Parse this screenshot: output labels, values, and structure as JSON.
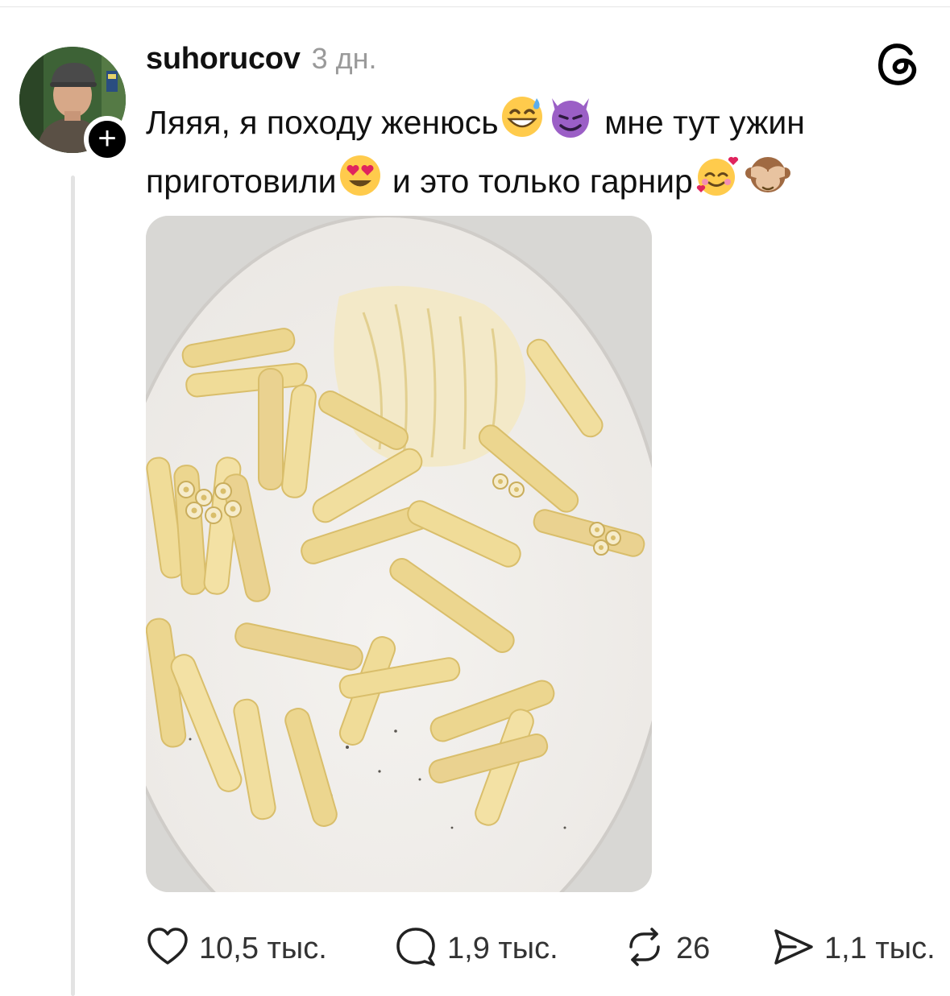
{
  "post": {
    "username": "suhorucov",
    "time_ago": "3 дн.",
    "follow_symbol": "+",
    "text_parts": [
      "Ляяя, я походу женюсь",
      "мне тут ужин",
      "приготовили",
      "и это только гарнир"
    ],
    "emoji_icons": [
      "grinning-sweat-emoji",
      "smiling-devil-emoji",
      "heart-eyes-emoji",
      "smiling-hearts-emoji",
      "see-no-evil-monkey-emoji"
    ],
    "image_alt": "Фото тарелки с макаронами"
  },
  "actions": {
    "likes": "10,5 тыс.",
    "comments": "1,9 тыс.",
    "reposts": "26",
    "shares": "1,1 тыс."
  },
  "colors": {
    "text": "#111111",
    "muted": "#9a9a9a",
    "thread_line": "#e3e3e3",
    "pasta": "#ecd68f",
    "plate": "#f1efec"
  }
}
